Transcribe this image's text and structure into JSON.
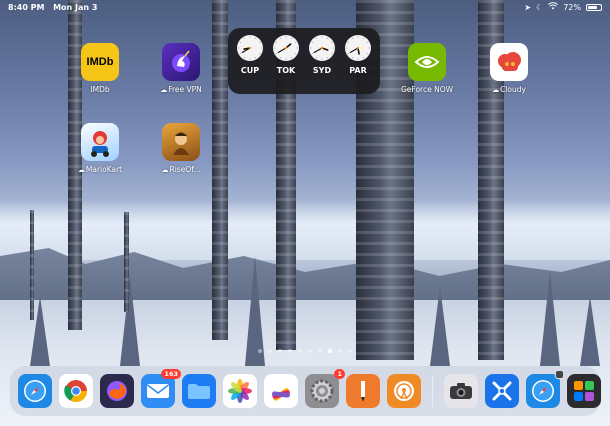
{
  "status": {
    "time": "8:40 PM",
    "date": "Mon Jan 3",
    "battery_percent": "72%",
    "battery_level": 0.72
  },
  "home_apps": [
    {
      "name": "imdb",
      "label": "IMDb",
      "cloud": false,
      "icon_text": "IMDb"
    },
    {
      "name": "free-vpn",
      "label": "Free VPN",
      "cloud": true
    },
    {
      "name": "geforce-now",
      "label": "GeForce NOW",
      "cloud": false
    },
    {
      "name": "cloudy",
      "label": "Cloudy",
      "cloud": true
    },
    {
      "name": "mariokart",
      "label": "MarioKart",
      "cloud": true
    },
    {
      "name": "rise-of",
      "label": "RiseOf...",
      "cloud": true
    }
  ],
  "clock_widget": {
    "clocks": [
      {
        "city": "CUP",
        "hour": 8,
        "minute": 40
      },
      {
        "city": "TOK",
        "hour": 1,
        "minute": 40
      },
      {
        "city": "SYD",
        "hour": 3,
        "minute": 40
      },
      {
        "city": "PAR",
        "hour": 5,
        "minute": 40
      }
    ]
  },
  "page_dots": {
    "count": 10,
    "active_index": 7
  },
  "dock": {
    "apps": [
      {
        "name": "safari",
        "color": "#1e88e5"
      },
      {
        "name": "chrome",
        "color": "#ffffff"
      },
      {
        "name": "firefox",
        "color": "#2b2a4c"
      },
      {
        "name": "mail",
        "color": "#2f8df5",
        "badge": "163"
      },
      {
        "name": "files",
        "color": "#1e7cf2"
      },
      {
        "name": "photos",
        "color": "#ffffff"
      },
      {
        "name": "pages-fan",
        "color": "#ffffff"
      },
      {
        "name": "settings",
        "color": "#8e8e93",
        "badge": "1"
      },
      {
        "name": "pixelmator",
        "color": "#f07a2b"
      },
      {
        "name": "overcast",
        "color": "#f08a24"
      },
      {
        "name": "camera",
        "color": "#e5e5ea",
        "after_separator": true
      },
      {
        "name": "testflight",
        "color": "#1a73e8"
      },
      {
        "name": "safari-recent",
        "color": "#1e88e5"
      },
      {
        "name": "app-library",
        "color": "#2c2c2e"
      }
    ]
  }
}
